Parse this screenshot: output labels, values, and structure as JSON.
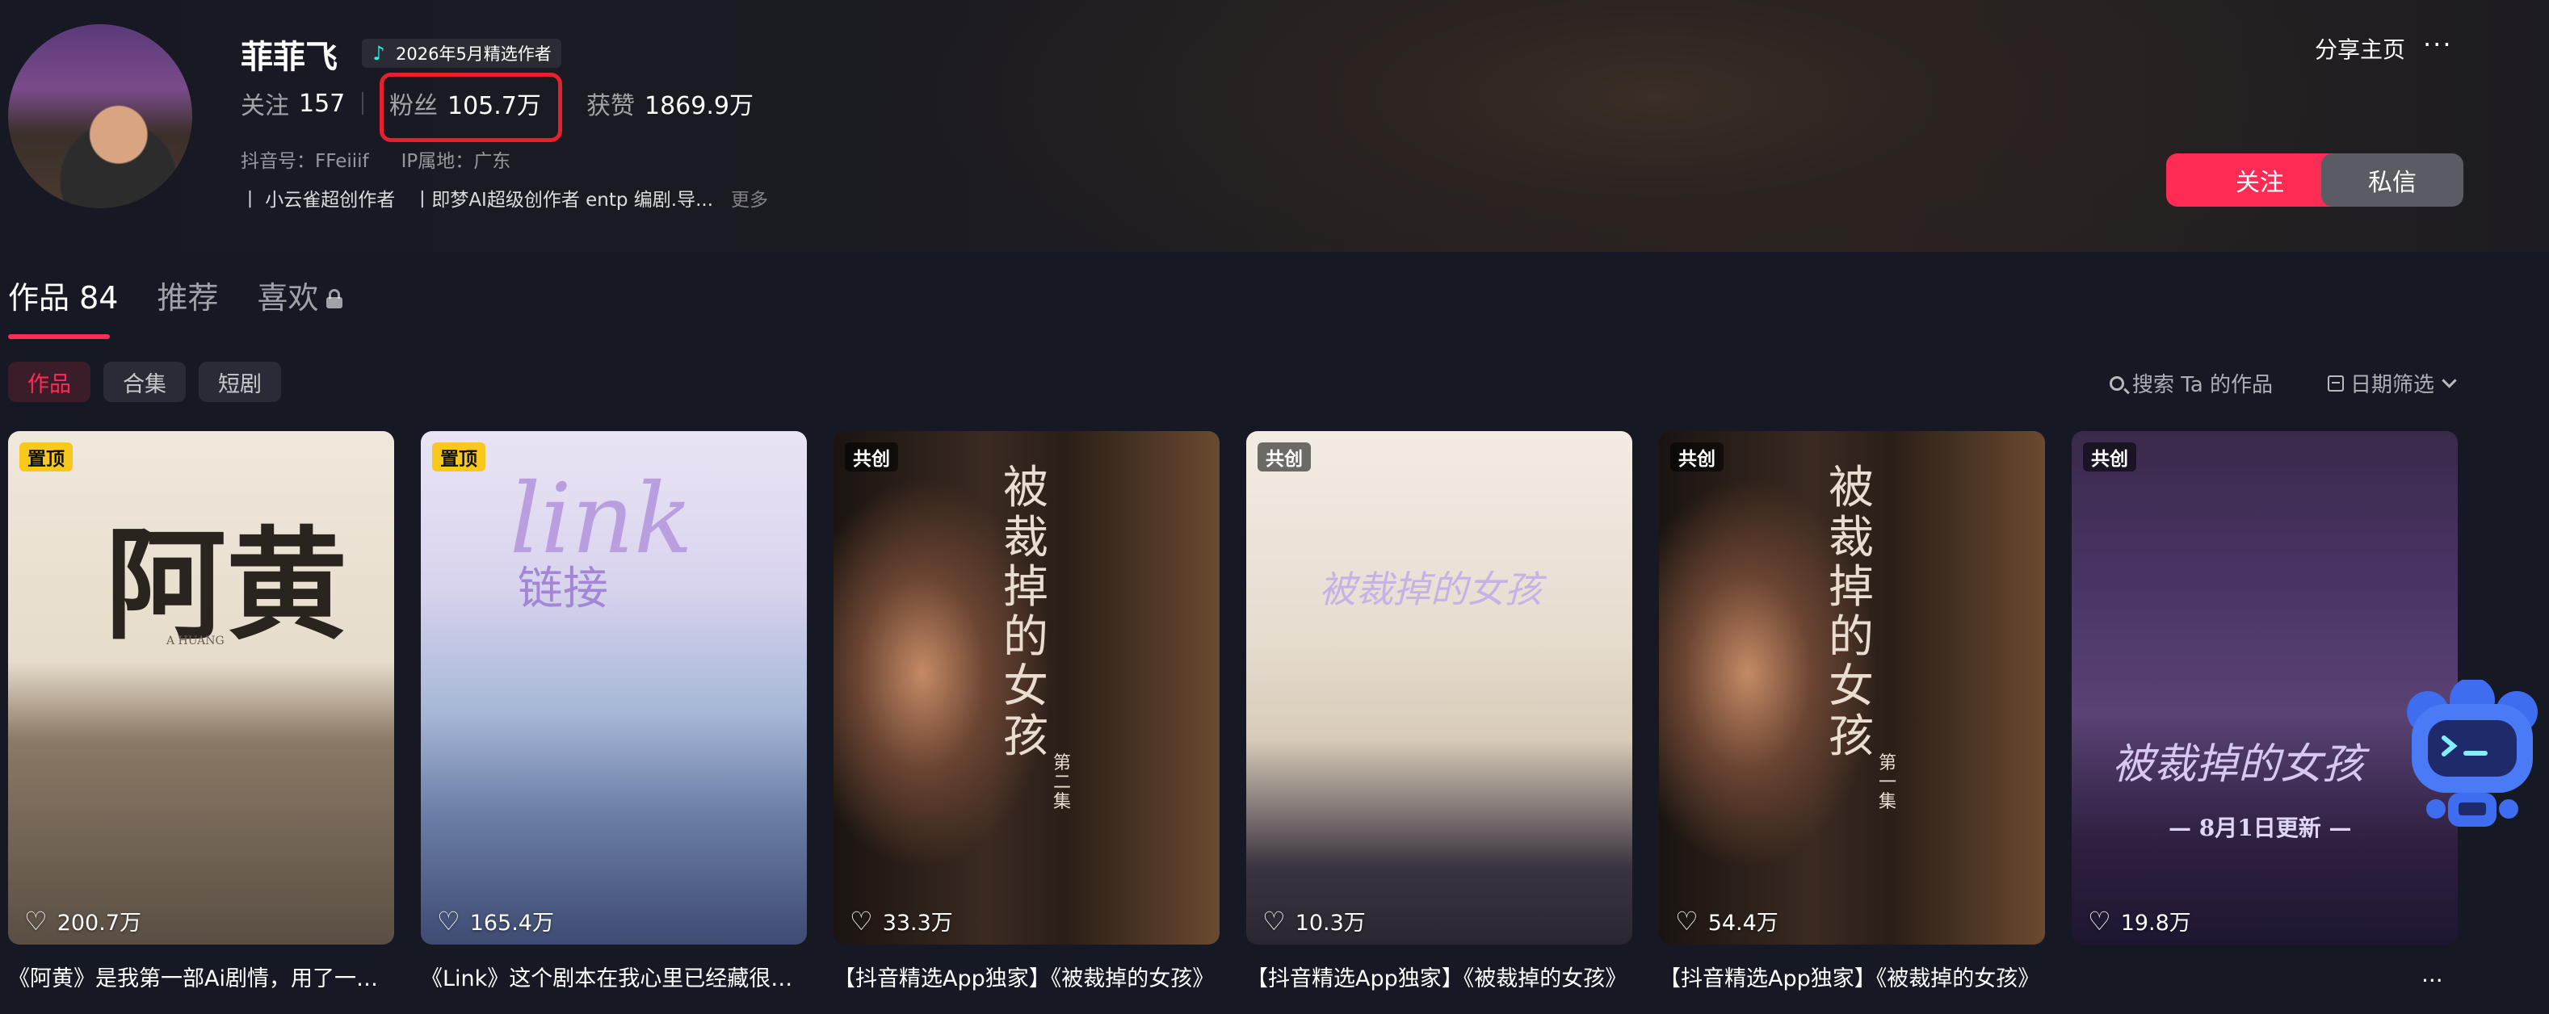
{
  "profile": {
    "name": "菲菲飞",
    "badge": "2026年5月精选作者",
    "following_label": "关注",
    "following": "157",
    "followers_label": "粉丝",
    "followers": "105.7万",
    "likes_label": "获赞",
    "likes": "1869.9万",
    "douyin_id": "抖音号：FFeiiif",
    "ip": "IP属地：广东",
    "bio": [
      "丨 小云雀超创作者",
      "丨即梦AI超级创作者 entp 编剧.导..."
    ],
    "bio_more": "更多"
  },
  "actions": {
    "share": "分享主页",
    "more": "···",
    "follow": "关注",
    "message": "私信"
  },
  "tabs": [
    {
      "label": "作品 84",
      "active": true
    },
    {
      "label": "推荐"
    },
    {
      "label": "喜欢"
    }
  ],
  "chips": [
    "作品",
    "合集",
    "短剧"
  ],
  "search": {
    "label": "搜索 Ta 的作品"
  },
  "date_filter": {
    "label": "日期筛选"
  },
  "videos": [
    {
      "tag": "置顶",
      "likes": "200.7万",
      "caption": "《阿黄》是我第一部Ai剧情，用了一个月时间制作",
      "poster_title": "阿黄",
      "poster_sub": "A HUANG"
    },
    {
      "tag": "置顶",
      "likes": "165.4万",
      "caption": "《Link》这个剧本在我心里已经藏很久了",
      "poster_title": "link",
      "poster_sub": "链接"
    },
    {
      "tag": "共创",
      "likes": "33.3万",
      "caption": "【抖音精选App独家】《被裁掉的女孩》",
      "poster_title": "被裁掉的女孩",
      "poster_sub": "第二集"
    },
    {
      "tag": "共创",
      "likes": "10.3万",
      "caption": "【抖音精选App独家】《被裁掉的女孩》",
      "poster_title": "被裁掉的女孩",
      "poster_sub": ""
    },
    {
      "tag": "共创",
      "likes": "54.4万",
      "caption": "【抖音精选App独家】《被裁掉的女孩》",
      "poster_title": "被裁掉的女孩",
      "poster_sub": "第一集"
    },
    {
      "tag": "共创",
      "likes": "19.8万",
      "caption": "",
      "poster_title": "被裁掉的女孩",
      "poster_sub": "— 8月1日更新 —"
    }
  ],
  "more_dots": "...",
  "colors": {
    "accent": "#fe2c55",
    "background": "#161823",
    "pin": "#f8c91c"
  }
}
